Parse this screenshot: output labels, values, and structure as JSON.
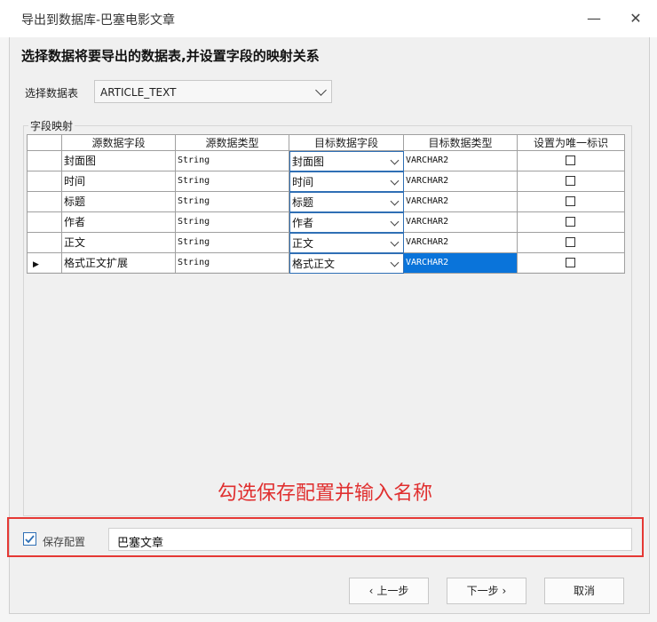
{
  "window": {
    "title": "导出到数据库-巴塞电影文章"
  },
  "heading": "选择数据将要导出的数据表,并设置字段的映射关系",
  "table_select": {
    "label": "选择数据表",
    "value": "ARTICLE_TEXT"
  },
  "mapping_group": {
    "label": "字段映射"
  },
  "grid": {
    "columns": [
      "源数据字段",
      "源数据类型",
      "目标数据字段",
      "目标数据类型",
      "设置为唯一标识"
    ],
    "rows": [
      {
        "source_field": "封面图",
        "source_type": "String",
        "target_field": "封面图",
        "target_type": "VARCHAR2",
        "unique": false
      },
      {
        "source_field": "时间",
        "source_type": "String",
        "target_field": "时间",
        "target_type": "VARCHAR2",
        "unique": false
      },
      {
        "source_field": "标题",
        "source_type": "String",
        "target_field": "标题",
        "target_type": "VARCHAR2",
        "unique": false
      },
      {
        "source_field": "作者",
        "source_type": "String",
        "target_field": "作者",
        "target_type": "VARCHAR2",
        "unique": false
      },
      {
        "source_field": "正文",
        "source_type": "String",
        "target_field": "正文",
        "target_type": "VARCHAR2",
        "unique": false
      },
      {
        "source_field": "格式正文扩展",
        "source_type": "String",
        "target_field": "格式正文",
        "target_type": "VARCHAR2",
        "unique": false
      }
    ]
  },
  "annotation": "勾选保存配置并输入名称",
  "save_config": {
    "label": "保存配置",
    "checked": true,
    "name_value": "巴塞文章"
  },
  "buttons": {
    "prev": "上一步",
    "next": "下一步",
    "cancel": "取消"
  },
  "colors": {
    "highlight": "#e53935",
    "selection": "#0a74da",
    "focus_border": "#2f6fb5"
  }
}
